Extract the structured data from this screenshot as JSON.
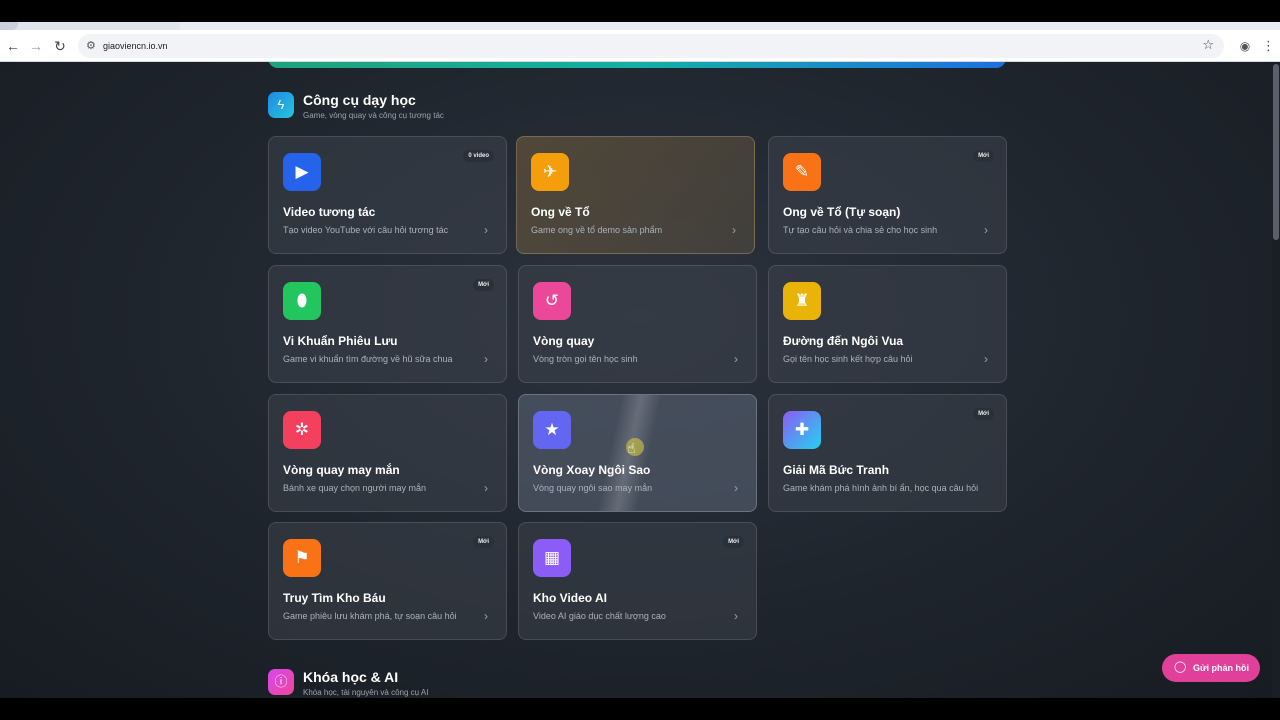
{
  "browser": {
    "url": "giaoviencn.io.vn"
  },
  "section_tools": {
    "title": "Công cụ dạy học",
    "subtitle": "Game, vòng quay và công cụ tương tác",
    "icon": "lightning-icon",
    "accent": "#1e88e5"
  },
  "cards": [
    {
      "title": "Video tương tác",
      "desc": "Tạo video YouTube với câu hỏi tương tác",
      "badge": "0 video",
      "icon": "video-camera-icon",
      "color": "#2563eb"
    },
    {
      "title": "Ong về Tổ",
      "desc": "Game ong về tổ demo sản phẩm",
      "badge": "",
      "icon": "bee-icon",
      "color": "#f59e0b"
    },
    {
      "title": "Ong về Tổ (Tự soạn)",
      "desc": "Tự tạo câu hỏi và chia sẻ cho học sinh",
      "badge": "Mới",
      "icon": "bee-notebook-icon",
      "color": "#f97316"
    },
    {
      "title": "Vi Khuẩn Phiêu Lưu",
      "desc": "Game vi khuẩn tìm đường về hũ sữa chua",
      "badge": "Mới",
      "icon": "bacteria-icon",
      "color": "#22c55e"
    },
    {
      "title": "Vòng quay",
      "desc": "Vòng tròn gọi tên học sinh",
      "badge": "",
      "icon": "rotate-icon",
      "color": "#ec4899"
    },
    {
      "title": "Đường đến Ngôi Vua",
      "desc": "Gọi tên học sinh kết hợp câu hỏi",
      "badge": "",
      "icon": "castle-icon",
      "color": "#eab308"
    },
    {
      "title": "Vòng quay may mắn",
      "desc": "Bánh xe quay chọn người may mắn",
      "badge": "",
      "icon": "ferris-wheel-icon",
      "color": "#f43f5e"
    },
    {
      "title": "Vòng Xoay Ngôi Sao",
      "desc": "Vòng quay ngôi sao may mắn",
      "badge": "",
      "icon": "star-icon",
      "color": "#6366f1"
    },
    {
      "title": "Giải Mã Bức Tranh",
      "desc": "Game khám phá hình ảnh bí ẩn, học qua câu hỏi",
      "badge": "Mới",
      "icon": "puzzle-icon",
      "color": "#8b5cf6"
    },
    {
      "title": "Truy Tìm Kho Báu",
      "desc": "Game phiêu lưu khám phá, tự soạn câu hỏi",
      "badge": "Mới",
      "icon": "pirate-flag-icon",
      "color": "#f97316"
    },
    {
      "title": "Kho Video AI",
      "desc": "Video AI giáo dục chất lượng cao",
      "badge": "Mới",
      "icon": "clapperboard-icon",
      "color": "#8b5cf6"
    }
  ],
  "section_courses": {
    "title": "Khóa học & AI",
    "subtitle": "Khóa học, tài nguyên và công cụ AI",
    "icon": "info-icon",
    "accent": "#d946ef"
  },
  "feedback": {
    "label": "Gửi phản hồi",
    "color": "#e0409a"
  }
}
